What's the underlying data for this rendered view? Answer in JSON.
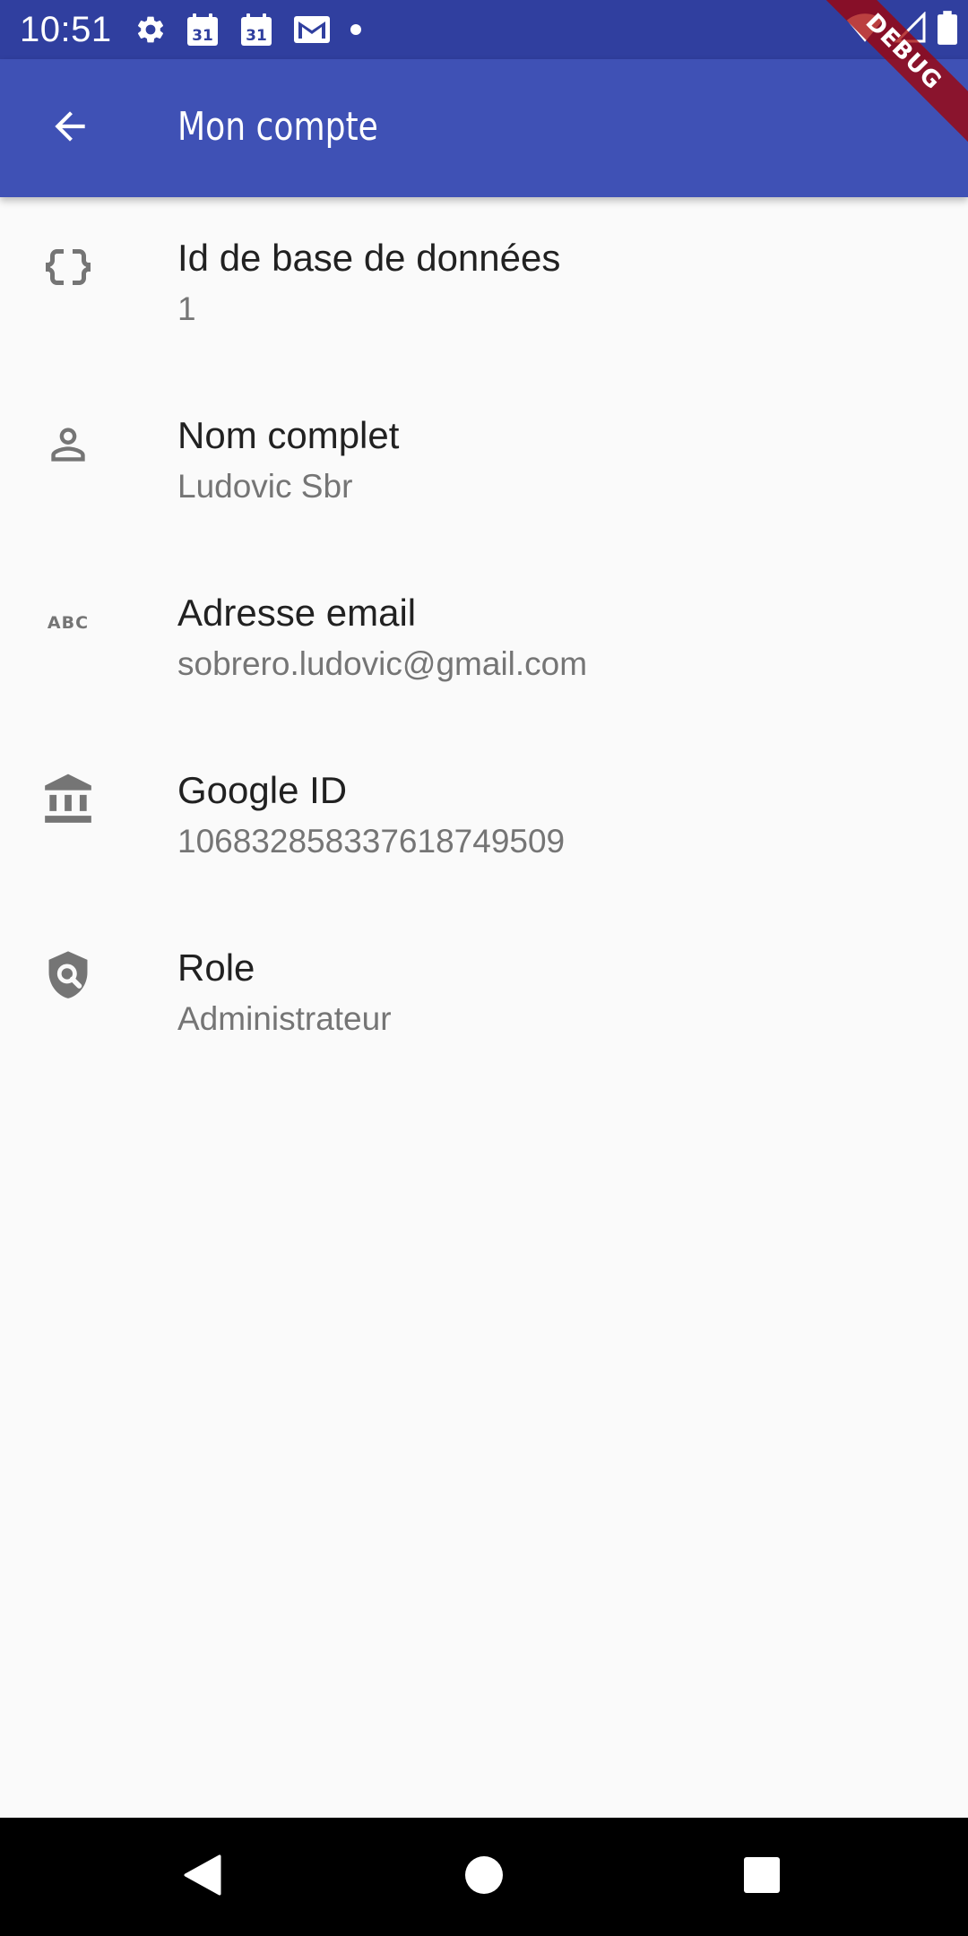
{
  "status_bar": {
    "time": "10:51",
    "calendar_day_1": "31",
    "calendar_day_2": "31",
    "icons": [
      "gear-icon",
      "calendar-icon",
      "calendar-icon",
      "gmail-icon",
      "dot-icon",
      "wifi-icon",
      "signal-icon",
      "battery-icon"
    ]
  },
  "app_bar": {
    "title": "Mon compte",
    "back_icon": "arrow-back-icon",
    "color": "#3F51B5"
  },
  "debug_banner": {
    "label": "DEBUG"
  },
  "account_details": [
    {
      "icon": "data-object-icon",
      "title": "Id de base de données",
      "value": "1"
    },
    {
      "icon": "person-icon",
      "title": "Nom complet",
      "value": "Ludovic Sbr"
    },
    {
      "icon": "abc-icon",
      "title": "Adresse email",
      "value": "sobrero.ludovic@gmail.com"
    },
    {
      "icon": "bank-icon",
      "title": "Google ID",
      "value": "106832858337618749509"
    },
    {
      "icon": "shield-search-icon",
      "title": "Role",
      "value": "Administrateur"
    }
  ],
  "navigation_bar": {
    "buttons": [
      "nav-back-icon",
      "nav-home-icon",
      "nav-recents-icon"
    ]
  }
}
